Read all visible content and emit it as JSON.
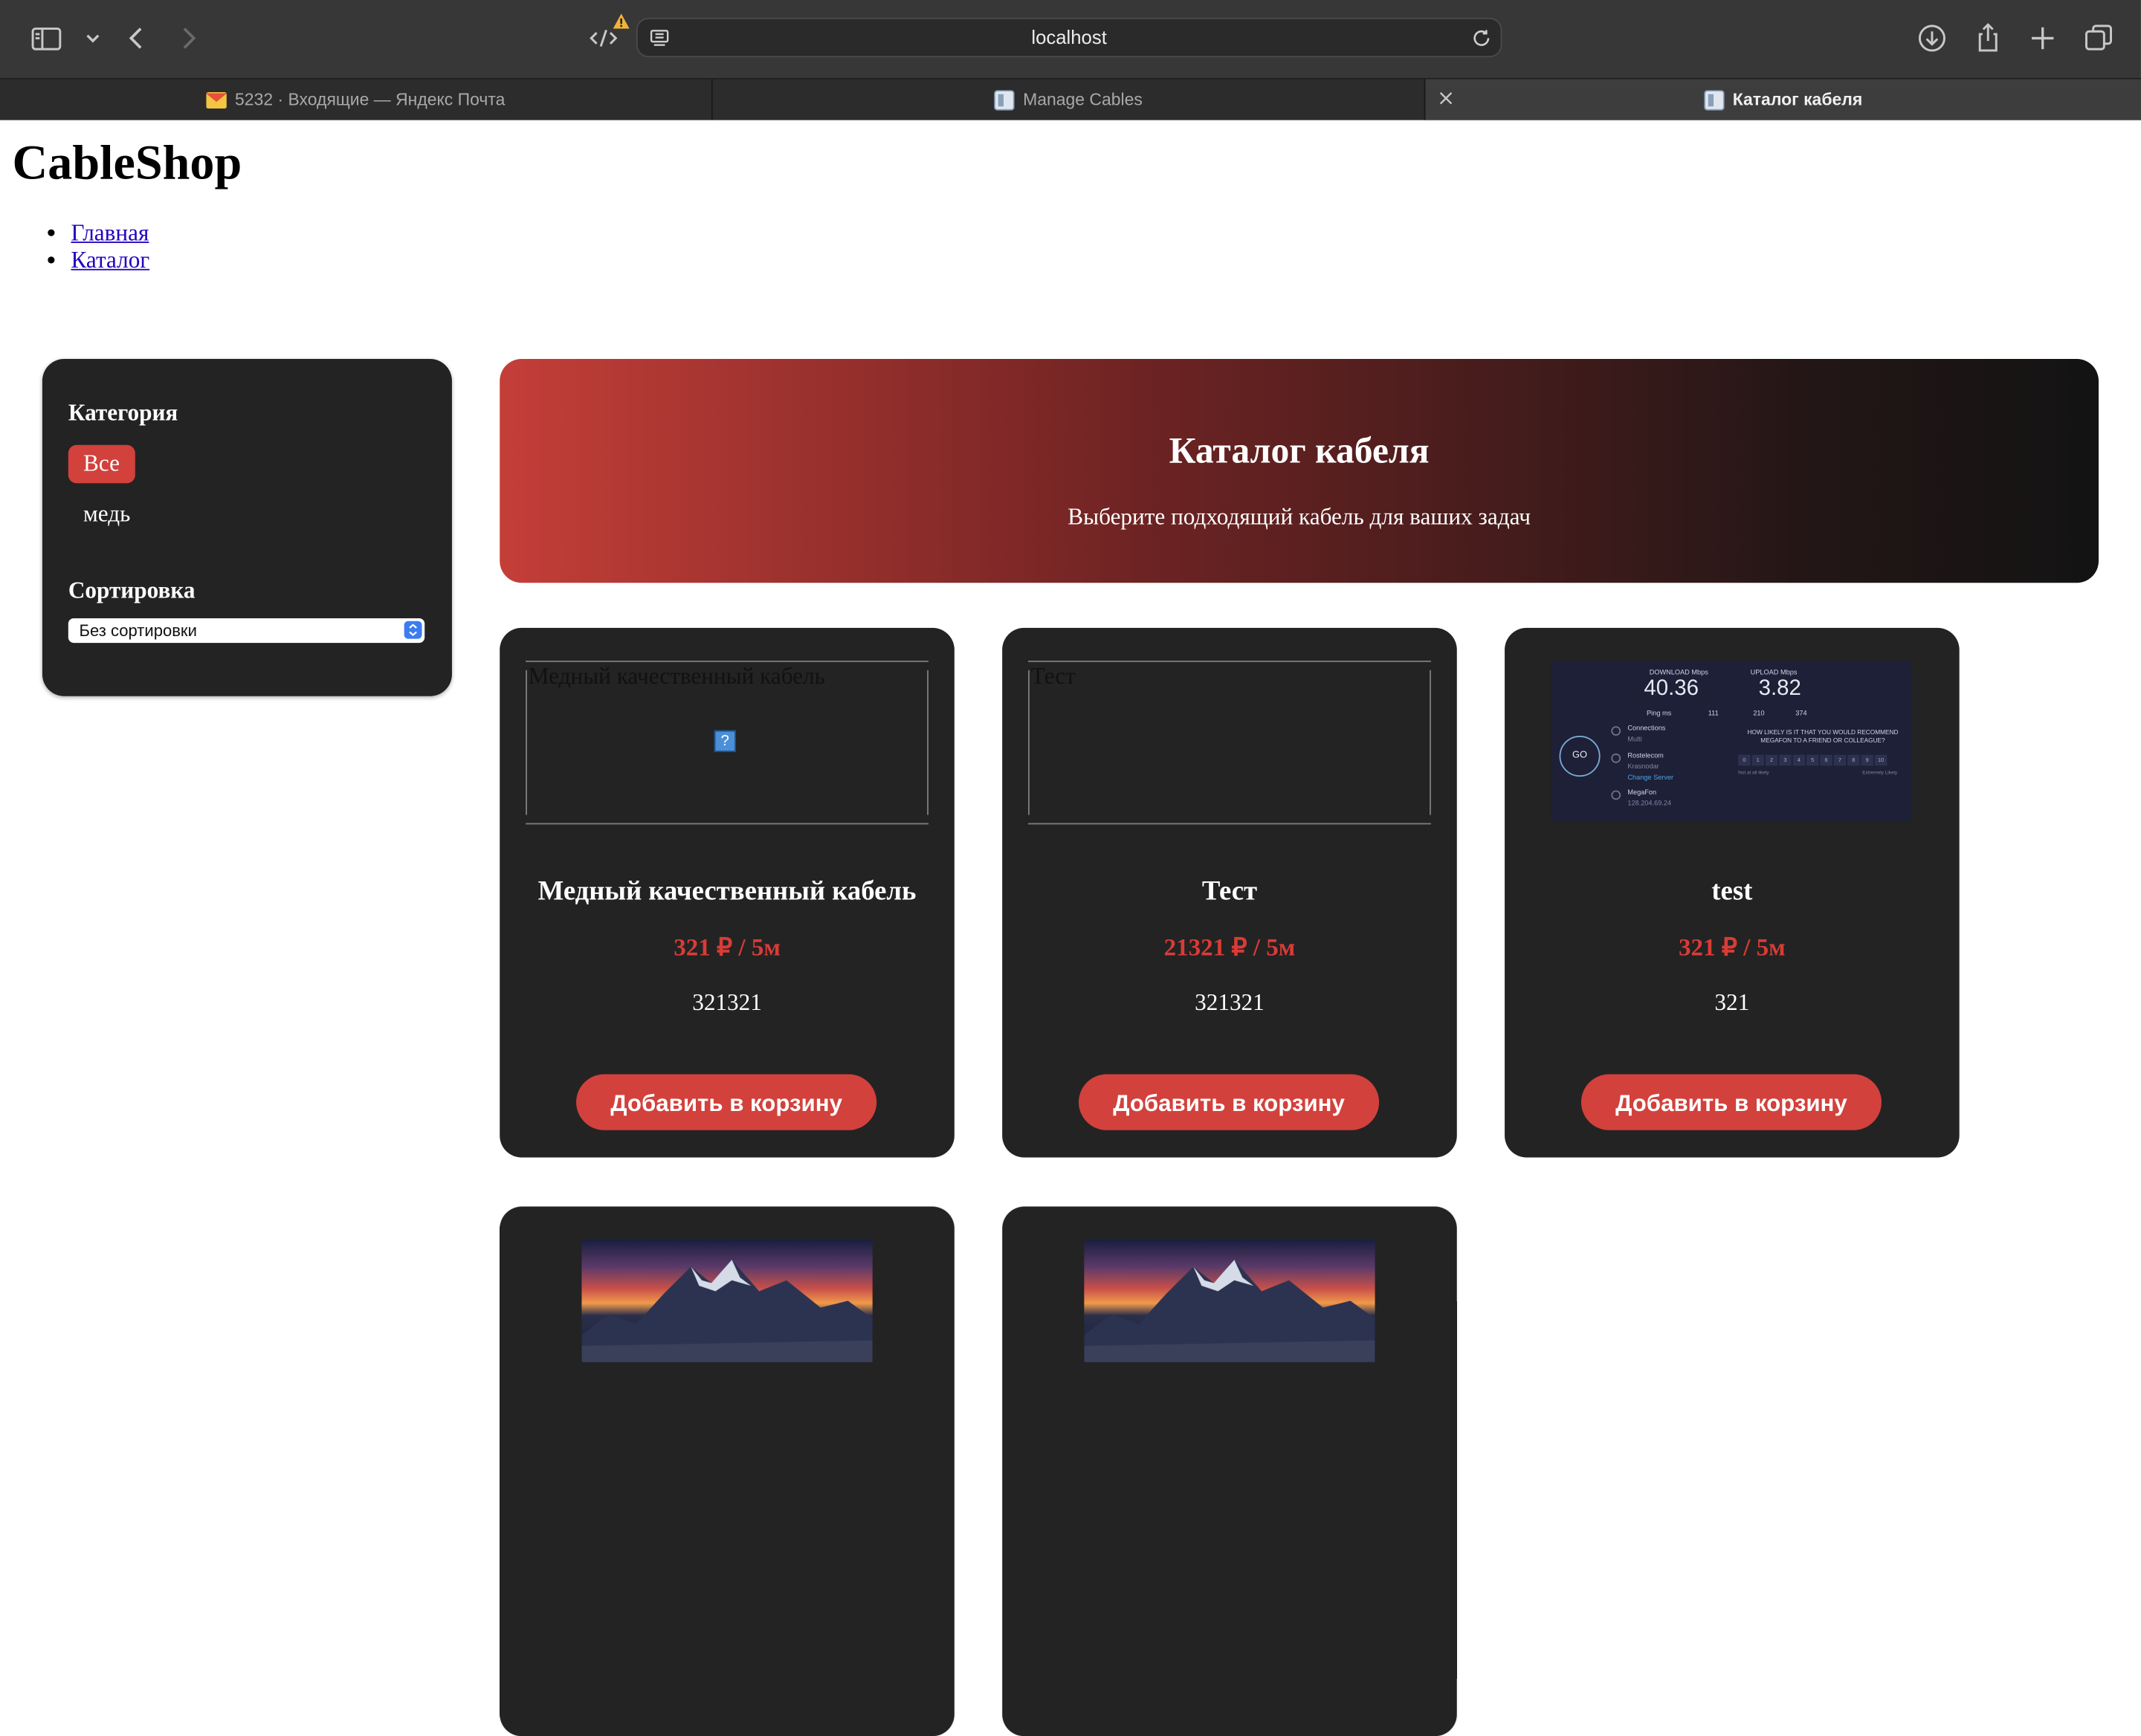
{
  "browser": {
    "url": "localhost",
    "tabs": [
      {
        "title": "5232 · Входящие — Яндекс Почта",
        "active": false
      },
      {
        "title": "Manage Cables",
        "active": false
      },
      {
        "title": "Каталог кабеля",
        "active": true
      }
    ]
  },
  "site": {
    "brand": "CableShop",
    "nav": [
      "Главная",
      "Каталог"
    ]
  },
  "sidebar": {
    "category_heading": "Категория",
    "categories": [
      {
        "label": "Все",
        "selected": true
      },
      {
        "label": "медь",
        "selected": false
      }
    ],
    "sort_heading": "Сортировка",
    "sort_selected": "Без сортировки"
  },
  "hero": {
    "title": "Каталог кабеля",
    "subtitle": "Выберите подходящий кабель для ваших задач"
  },
  "products": [
    {
      "title": "Медный качественный кабель",
      "price": "321 ₽ / 5м",
      "description": "321321",
      "image_alt": "Медный качественный кабель",
      "button": "Добавить в корзину"
    },
    {
      "title": "Тест",
      "price": "21321 ₽ / 5м",
      "description": "321321",
      "image_alt": "Тест",
      "button": "Добавить в корзину"
    },
    {
      "title": "test",
      "price": "321 ₽ / 5м",
      "description": "321",
      "button": "Добавить в корзину"
    }
  ],
  "speedtest_thumb": {
    "download_label": "DOWNLOAD Mbps",
    "download_value": "40.36",
    "upload_label": "UPLOAD Mbps",
    "upload_value": "3.82",
    "ping_label": "Ping ms",
    "ping_values": [
      "111",
      "210",
      "374"
    ],
    "go": "GO",
    "connections_label": "Connections",
    "connections_value": "Multi",
    "server_name": "Rostelecom",
    "server_city": "Krasnodar",
    "change_server": "Change Server",
    "isp_name": "MegaFon",
    "isp_ip": "128.204.69.24",
    "question": "HOW LIKELY IS IT THAT YOU WOULD RECOMMEND MEGAFON TO A FRIEND OR COLLEAGUE?",
    "scale": [
      "0",
      "1",
      "2",
      "3",
      "4",
      "5",
      "6",
      "7",
      "8",
      "9",
      "10"
    ],
    "scale_low": "Not at all likely",
    "scale_high": "Extremely Likely"
  },
  "colors": {
    "accent": "#d2413c",
    "price": "#d83c36",
    "card_bg": "#232323",
    "link": "#2300bf"
  }
}
